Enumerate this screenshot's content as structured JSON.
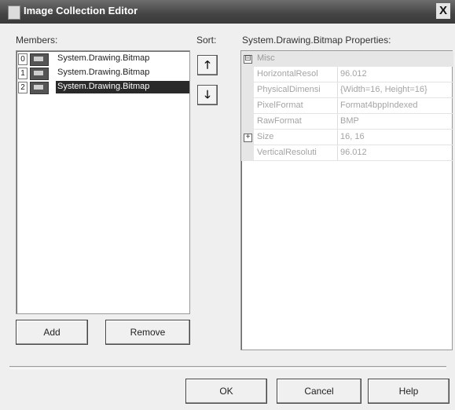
{
  "window": {
    "title": "Image Collection Editor",
    "close_glyph": "X"
  },
  "members": {
    "label": "Members:",
    "items": [
      {
        "index": "0",
        "text": "System.Drawing.Bitmap",
        "selected": false
      },
      {
        "index": "1",
        "text": "System.Drawing.Bitmap",
        "selected": false
      },
      {
        "index": "2",
        "text": "System.Drawing.Bitmap",
        "selected": true
      }
    ]
  },
  "sort": {
    "label": "Sort:",
    "up_glyph": "🡑",
    "down_glyph": "🡓"
  },
  "properties": {
    "label": "System.Drawing.Bitmap  Properties:",
    "category": {
      "toggle": "⊟",
      "name": "Misc"
    },
    "rows": [
      {
        "name": "HorizontalResol",
        "value": "96.012"
      },
      {
        "name": "PhysicalDimensi",
        "value": "{Width=16, Height=16}"
      },
      {
        "name": "PixelFormat",
        "value": "Format4bppIndexed"
      },
      {
        "name": "RawFormat",
        "value": "BMP"
      },
      {
        "name": "Size",
        "value": "16, 16",
        "expand": "+"
      },
      {
        "name": "VerticalResoluti",
        "value": "96.012"
      }
    ]
  },
  "buttons": {
    "add": "Add",
    "remove": "Remove",
    "ok": "OK",
    "cancel": "Cancel",
    "help": "Help"
  }
}
